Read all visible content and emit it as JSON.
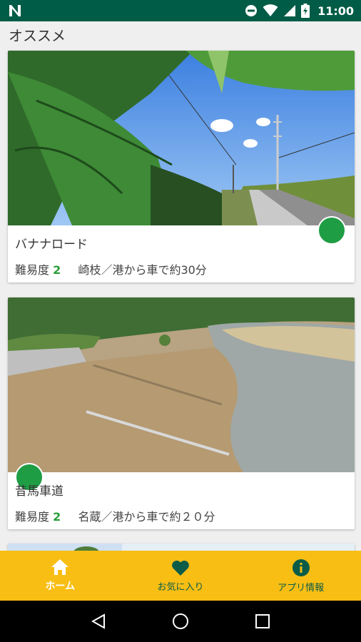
{
  "status_bar": {
    "time": "11:00"
  },
  "section": {
    "title": "オススメ"
  },
  "cards": [
    {
      "title": "バナナロード",
      "level_label": "難易度",
      "level": "2",
      "detail": "崎枝／港から車で約30分"
    },
    {
      "title": "昔馬車道",
      "level_label": "難易度",
      "level": "2",
      "detail": "名蔵／港から車で約２０分"
    }
  ],
  "bottom_nav": {
    "items": [
      {
        "label": "ホーム",
        "icon": "home-icon"
      },
      {
        "label": "お気に入り",
        "icon": "heart-icon"
      },
      {
        "label": "アプリ情報",
        "icon": "info-icon"
      }
    ]
  },
  "colors": {
    "status_bar": "#005c46",
    "nav_bar": "#f8be14",
    "level": "#2a9d3a",
    "badge": "#1f9d45"
  }
}
